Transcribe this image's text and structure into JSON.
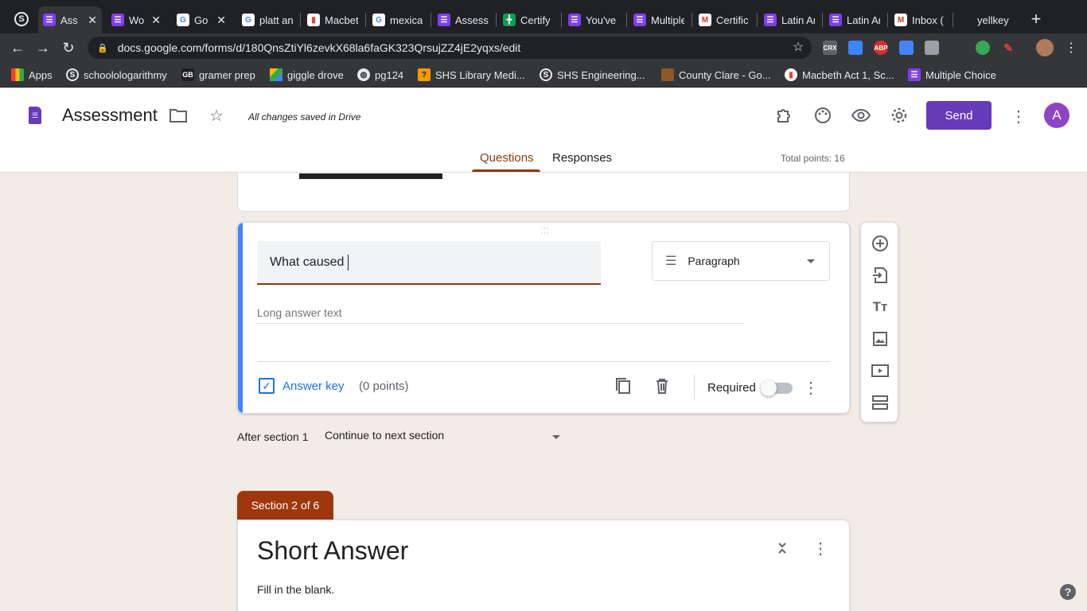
{
  "tabs": [
    {
      "label": "",
      "icon": "schoology-icon",
      "color": "#202124"
    },
    {
      "label": "Ass",
      "icon": "forms-icon",
      "color": "#7e3ff2"
    },
    {
      "label": "Wo",
      "icon": "forms-icon",
      "color": "#7e3ff2"
    },
    {
      "label": "Go",
      "icon": "google-icon",
      "color": "#ffffff"
    },
    {
      "label": "platt an",
      "icon": "google-icon",
      "color": "#ffffff"
    },
    {
      "label": "Macbet",
      "icon": "chart-icon",
      "color": "#ffffff"
    },
    {
      "label": "mexica",
      "icon": "google-icon",
      "color": "#ffffff"
    },
    {
      "label": "Assess",
      "icon": "forms-icon",
      "color": "#7e3ff2"
    },
    {
      "label": "Certify",
      "icon": "sheets-icon",
      "color": "#0f9d58"
    },
    {
      "label": "You've",
      "icon": "forms-icon",
      "color": "#7e3ff2"
    },
    {
      "label": "Multiple",
      "icon": "forms-icon",
      "color": "#7e3ff2"
    },
    {
      "label": "Certific",
      "icon": "gmail-icon",
      "color": "#ffffff"
    },
    {
      "label": "Latin Ar",
      "icon": "forms-icon",
      "color": "#7e3ff2"
    },
    {
      "label": "Latin Ar",
      "icon": "forms-icon",
      "color": "#7e3ff2"
    },
    {
      "label": "Inbox (",
      "icon": "gmail-icon",
      "color": "#ffffff"
    },
    {
      "label": "yellkey",
      "icon": "",
      "color": ""
    }
  ],
  "tab_close": "✕",
  "new_tab": "+",
  "url": "docs.google.com/forms/d/180QnsZtiYl6zevkX68la6faGK323QrsujZZ4jE2yqxs/edit",
  "extensions": [
    {
      "label": "CRX",
      "color": "#5f6368"
    },
    {
      "label": "",
      "color": "#3a86ff"
    },
    {
      "label": "ABP",
      "color": "#d32f2f"
    },
    {
      "label": "",
      "color": "#4285f4"
    },
    {
      "label": "",
      "color": "#9aa0a6"
    },
    {
      "label": "",
      "color": "#35363a"
    },
    {
      "label": "",
      "color": "#34a853"
    },
    {
      "label": "",
      "color": "#e53935"
    }
  ],
  "bookmarks": [
    {
      "label": "Apps",
      "icon": "apps-grid-icon"
    },
    {
      "label": "schoolologarithmy",
      "icon": "schoology-icon"
    },
    {
      "label": "gramer prep",
      "icon": "gb-icon"
    },
    {
      "label": "giggle drove",
      "icon": "drive-icon"
    },
    {
      "label": "pg124",
      "icon": "globe-icon"
    },
    {
      "label": "SHS Library Medi...",
      "icon": "library-icon"
    },
    {
      "label": "SHS Engineering...",
      "icon": "schoology-icon"
    },
    {
      "label": "County Clare - Go...",
      "icon": "image-icon"
    },
    {
      "label": "Macbeth Act 1, Sc...",
      "icon": "chart-icon"
    },
    {
      "label": "Multiple Choice",
      "icon": "forms-icon"
    }
  ],
  "header": {
    "title": "Assessment",
    "save_status": "All changes saved in Drive",
    "send": "Send",
    "avatar": "A",
    "tabs": [
      "Questions",
      "Responses"
    ],
    "total_points": "Total points: 16",
    "accent": "#673ab7"
  },
  "question": {
    "title": "What caused ",
    "type": "Paragraph",
    "placeholder": "Long answer text",
    "answer_key": "Answer key",
    "points": "(0 points)",
    "required": "Required",
    "required_on": false
  },
  "after_section": {
    "label": "After section 1",
    "value": "Continue to next section"
  },
  "section2": {
    "badge": "Section 2 of 6",
    "title": "Short Answer",
    "description": "Fill in the blank.",
    "badge_color": "#a0360d"
  },
  "help": "?"
}
